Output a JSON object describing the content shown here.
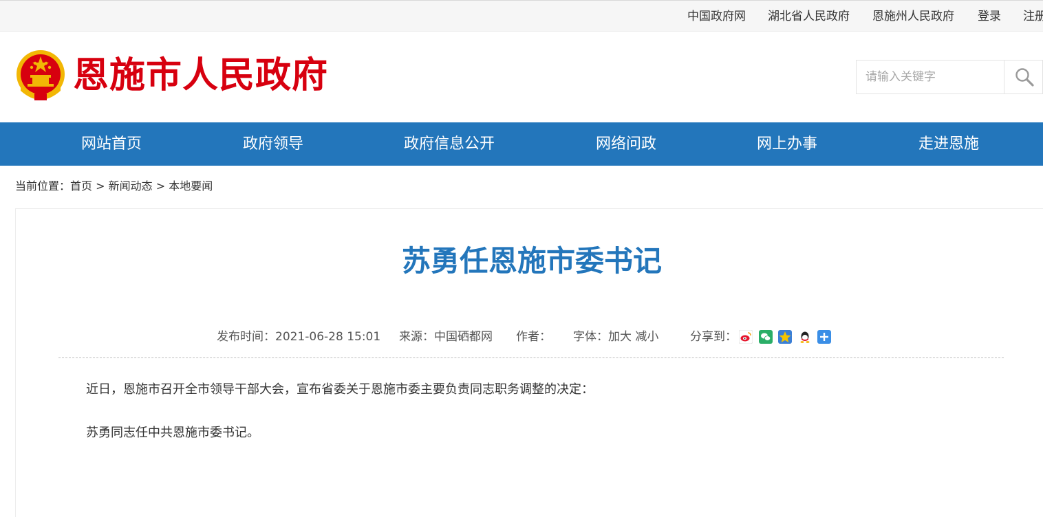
{
  "topbar": {
    "links": [
      "中国政府网",
      "湖北省人民政府",
      "恩施州人民政府",
      "登录",
      "注册"
    ]
  },
  "header": {
    "site_title": "恩施市人民政府",
    "search_placeholder": "请输入关键字"
  },
  "nav": {
    "items": [
      "网站首页",
      "政府领导",
      "政府信息公开",
      "网络问政",
      "网上办事",
      "走进恩施"
    ]
  },
  "breadcrumb": {
    "label": "当前位置：",
    "items": [
      "首页",
      "新闻动态",
      "本地要闻"
    ],
    "separator": " > "
  },
  "article": {
    "title": "苏勇任恩施市委书记",
    "publish_label": "发布时间：",
    "publish_time": "2021-06-28 15:01",
    "source_label": "来源：",
    "source": "中国硒都网",
    "author_label": "作者：",
    "author": "",
    "font_label": "字体：",
    "font_larger": "加大",
    "font_smaller": "减小",
    "share_label": "分享到：",
    "paragraphs": [
      "近日，恩施市召开全市领导干部大会，宣布省委关于恩施市委主要负责同志职务调整的决定：",
      "苏勇同志任中共恩施市委书记。"
    ]
  },
  "share_icons": [
    {
      "name": "weibo-icon",
      "color": "#e6162d"
    },
    {
      "name": "wechat-icon",
      "color": "#2aae67"
    },
    {
      "name": "qzone-icon",
      "color": "#f5b400"
    },
    {
      "name": "qq-icon",
      "color": "#3b8be0"
    },
    {
      "name": "more-icon",
      "color": "#3a8ee6"
    }
  ],
  "colors": {
    "brand_red": "#d7000f",
    "brand_blue": "#2376bb"
  }
}
